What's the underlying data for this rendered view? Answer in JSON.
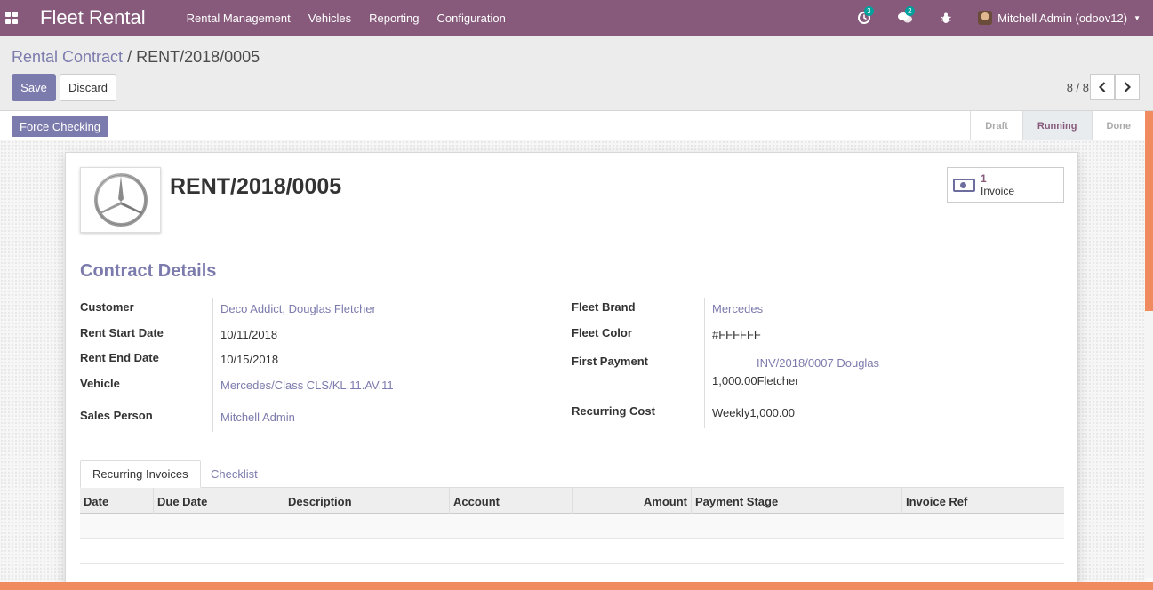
{
  "topbar": {
    "brand": "Fleet Rental",
    "menu": [
      "Rental Management",
      "Vehicles",
      "Reporting",
      "Configuration"
    ],
    "activity_count": "3",
    "messages_count": "2",
    "user_name": "Mitchell Admin (odoov12)"
  },
  "breadcrumb": {
    "parent": "Rental Contract",
    "separator": "/",
    "current": "RENT/2018/0005"
  },
  "toolbar": {
    "save_label": "Save",
    "discard_label": "Discard",
    "pager": "8 / 8"
  },
  "statusbar": {
    "action_label": "Force Checking",
    "stages": [
      "Draft",
      "Running",
      "Done"
    ],
    "active_stage": "Running"
  },
  "record": {
    "title": "RENT/2018/0005",
    "smart_button": {
      "value": "1",
      "label": "Invoice"
    },
    "section_title": "Contract Details",
    "left_fields": [
      {
        "label": "Customer",
        "value": "Deco Addict, Douglas Fletcher"
      },
      {
        "label": "Rent Start Date",
        "value": "10/11/2018"
      },
      {
        "label": "Rent End Date",
        "value": "10/15/2018"
      },
      {
        "label": "Vehicle",
        "value": "Mercedes/Class CLS/KL.11.AV.11"
      },
      {
        "label": "Sales Person",
        "value": "Mitchell Admin"
      }
    ],
    "right_fields": [
      {
        "label": "Fleet Brand",
        "value": "Mercedes"
      },
      {
        "label": "Fleet Color",
        "value": "#FFFFFF"
      },
      {
        "label": "First Payment",
        "value_line1": "INV/2018/0007 Douglas",
        "value_line2": "1,000.00Fletcher"
      },
      {
        "label": "Recurring Cost",
        "value": "Weekly1,000.00"
      }
    ]
  },
  "notebook": {
    "tabs": [
      "Recurring Invoices",
      "Checklist"
    ],
    "columns": [
      "Date",
      "Due Date",
      "Description",
      "Account",
      "Amount",
      "Payment Stage",
      "Invoice Ref"
    ]
  },
  "colors": {
    "primary": "#875a7b",
    "accent": "#7c7bad",
    "orange": "#ef8b5e"
  }
}
